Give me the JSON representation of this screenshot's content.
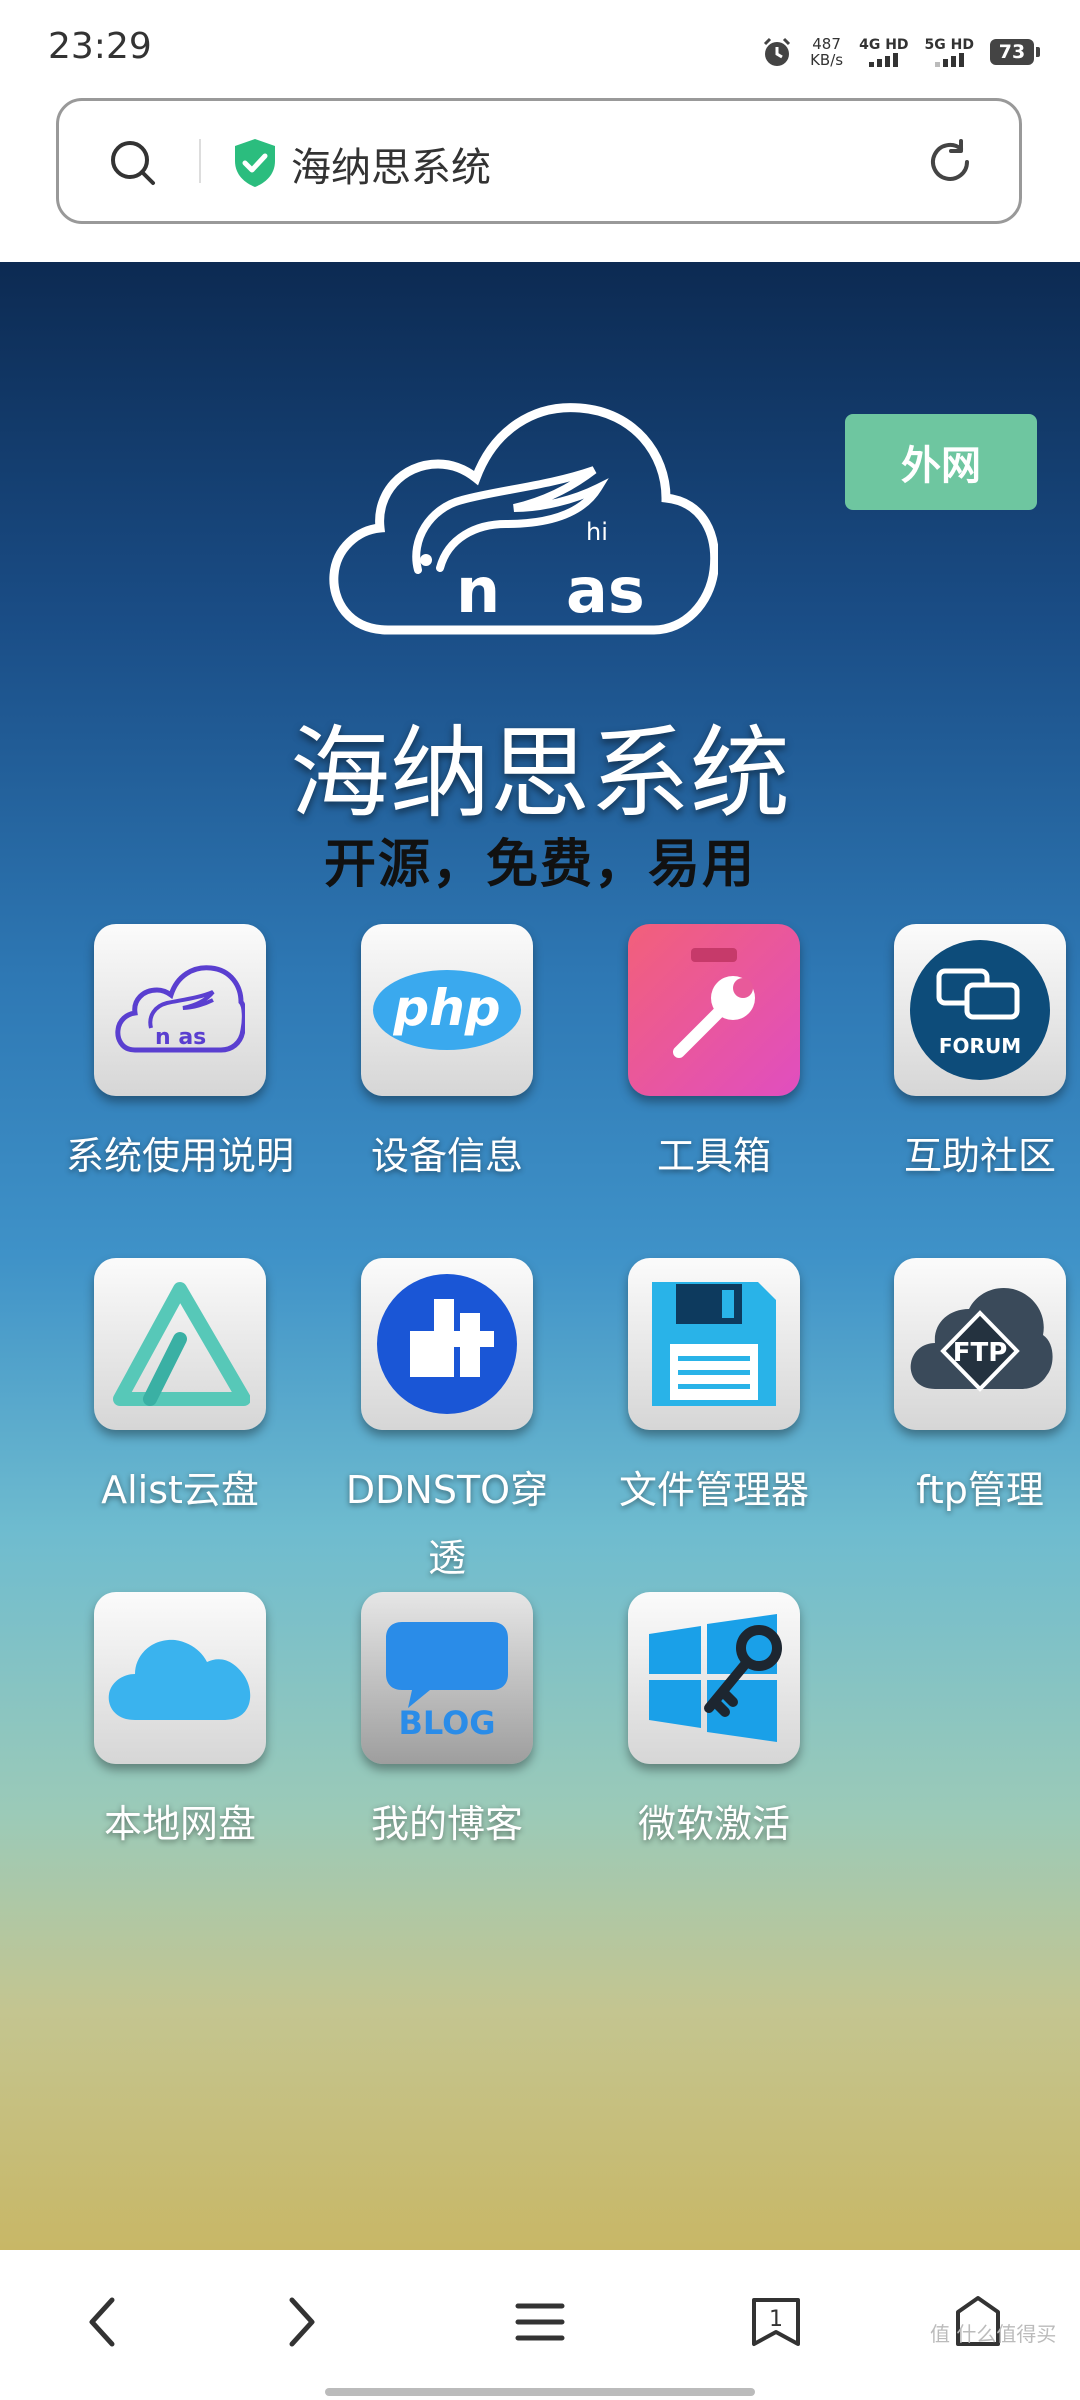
{
  "status_bar": {
    "time": "23:29",
    "speed_value": "487",
    "speed_unit": "KB/s",
    "network1": "4G HD",
    "network2": "5G HD",
    "battery": "73"
  },
  "url_bar": {
    "page_title": "海纳思系统"
  },
  "page": {
    "external_button": "外网",
    "title": "海纳思系统",
    "subtitle": "开源，免费，易用"
  },
  "apps": [
    {
      "label": "系统使用说明",
      "icon": "nas-logo-icon"
    },
    {
      "label": "设备信息",
      "icon": "php-icon"
    },
    {
      "label": "工具箱",
      "icon": "toolbox-icon"
    },
    {
      "label": "互助社区",
      "icon": "forum-icon"
    },
    {
      "label": "Alist云盘",
      "icon": "alist-icon"
    },
    {
      "label": "DDNSTO穿透",
      "icon": "ddnsto-icon"
    },
    {
      "label": "文件管理器",
      "icon": "floppy-disk-icon"
    },
    {
      "label": "ftp管理",
      "icon": "ftp-cloud-icon"
    },
    {
      "label": "本地网盘",
      "icon": "cloud-icon"
    },
    {
      "label": "我的博客",
      "icon": "blog-icon"
    },
    {
      "label": "微软激活",
      "icon": "windows-key-icon"
    }
  ],
  "icon_texts": {
    "forum": "FORUM",
    "ftp": "FTP",
    "blog": "BLOG",
    "php": "php"
  },
  "bottom_nav": {
    "tabs_count": "1",
    "watermark": "值 什么值得买"
  },
  "colors": {
    "external_button": "#6ec6a0",
    "secure_shield": "#2bbd7e"
  }
}
